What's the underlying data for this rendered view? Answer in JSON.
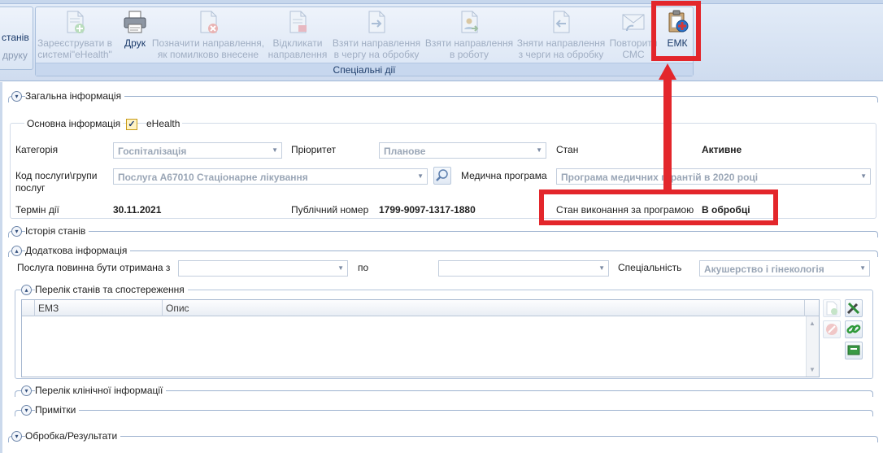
{
  "ribbon": {
    "left_group": {
      "line1": "станів",
      "line2": "друку"
    },
    "group_caption": "Спеціальні дії",
    "buttons": [
      {
        "id": "register",
        "line1": "Зареєструвати в",
        "line2": "системі\"eHealth\"",
        "icon": "document-add-icon",
        "enabled": false
      },
      {
        "id": "print",
        "line1": "Друк",
        "line2": "",
        "icon": "printer-icon",
        "enabled": true
      },
      {
        "id": "mark-error",
        "line1": "Позначити направлення,",
        "line2": "як помилково внесене",
        "icon": "document-cancel-icon",
        "enabled": false
      },
      {
        "id": "recall",
        "line1": "Відкликати",
        "line2": "направлення",
        "icon": "document-recall-icon",
        "enabled": false
      },
      {
        "id": "take-queue",
        "line1": "Взяти направлення",
        "line2": "в чергу на обробку",
        "icon": "document-arrow-right-icon",
        "enabled": false
      },
      {
        "id": "take-work",
        "line1": "Взяти направлення",
        "line2": "в роботу",
        "icon": "document-person-icon",
        "enabled": false
      },
      {
        "id": "remove-queue",
        "line1": "Зняти направлення",
        "line2": "з черги на обробку",
        "icon": "document-arrow-left-icon",
        "enabled": false
      },
      {
        "id": "repeat-sms",
        "line1": "Повторити",
        "line2": "СМС",
        "icon": "envelope-icon",
        "enabled": false
      },
      {
        "id": "emk",
        "line1": "ЕМК",
        "line2": "",
        "icon": "medical-record-icon",
        "enabled": true
      }
    ]
  },
  "sections": {
    "general": "Загальна інформація",
    "state_history": "Історія станів",
    "additional": "Додаткова інформація",
    "states_list": "Перелік станів та спостереження",
    "clinical_list": "Перелік клінічної інформації",
    "notes": "Примітки",
    "processing": "Обробка/Результати"
  },
  "main_info": {
    "title": "Основна інформація",
    "ehealth_label": "eHealth",
    "ehealth_checked": true,
    "category_label": "Категорія",
    "category_value": "Госпіталізація",
    "priority_label": "Пріоритет",
    "priority_value": "Планове",
    "state_label": "Стан",
    "state_value": "Активне",
    "service_label_1": "Код послуги\\групи",
    "service_label_2": "послуг",
    "service_value": "Послуга А67010 Стаціонарне лікування",
    "program_label": "Медична програма",
    "program_value": "Програма медичних гарантій в 2020 році",
    "term_label": "Термін дії",
    "term_value": "30.11.2021",
    "public_label": "Публічний номер",
    "public_value": "1799-9097-1317-1880",
    "exec_label": "Стан виконання за програмою",
    "exec_value": "В обробці"
  },
  "additional_info": {
    "from_label": "Послуга повинна бути отримана з",
    "from_value": "",
    "to_label": "по",
    "to_value": "",
    "specialty_label": "Спеціальність",
    "specialty_value": "Акушерство і гінекологія"
  },
  "grid": {
    "columns": [
      "ЕМЗ",
      "Опис"
    ]
  },
  "colors": {
    "highlight": "#e3262b",
    "ribbon_bg": "#dae5f4",
    "accent_text": "#1a3a6a"
  }
}
